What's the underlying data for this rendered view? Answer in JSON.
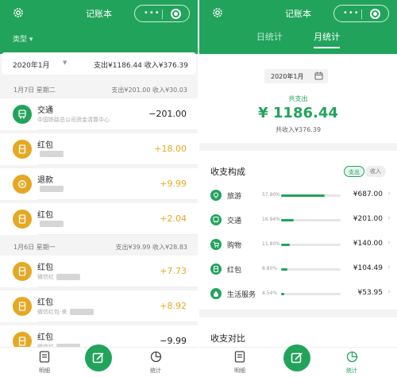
{
  "app": {
    "title": "记账本",
    "capsule_dots": "•••"
  },
  "colors": {
    "brand": "#22a35c",
    "income": "#e5a823",
    "expense": "#222222"
  },
  "left": {
    "type_filter": "类型",
    "month_bar": {
      "month": "2020年1月",
      "summary": "支出¥1186.44   收入¥376.39"
    },
    "days": [
      {
        "date": "1月7日 星期二",
        "summary": "支出¥201.00  收入¥30.03",
        "records": [
          {
            "category": "交通",
            "note": "中国铁路总公司资金清算中心",
            "amount": "−201.00",
            "kind": "expense",
            "icon": "bus-icon"
          },
          {
            "category": "红包",
            "note": "",
            "amount": "+18.00",
            "kind": "income",
            "icon": "envelope-icon"
          },
          {
            "category": "退款",
            "note": "",
            "amount": "+9.99",
            "kind": "income",
            "icon": "refund-icon"
          },
          {
            "category": "红包",
            "note": "",
            "amount": "+2.04",
            "kind": "income",
            "icon": "envelope-icon"
          }
        ]
      },
      {
        "date": "1月6日 星期一",
        "summary": "支出¥39.99  收入¥28.83",
        "records": [
          {
            "category": "红包",
            "note": "微信红",
            "amount": "+7.73",
            "kind": "income",
            "icon": "envelope-icon"
          },
          {
            "category": "红包",
            "note": "微信红包-来",
            "amount": "+8.92",
            "kind": "income",
            "icon": "envelope-icon"
          },
          {
            "category": "红包",
            "note": "微信红",
            "amount": "−9.99",
            "kind": "expense",
            "icon": "envelope-icon"
          }
        ]
      }
    ],
    "nav": {
      "details": "明细",
      "stats": "统计"
    }
  },
  "right": {
    "tabs": {
      "daily": "日统计",
      "monthly": "月统计"
    },
    "month": "2020年1月",
    "expense_label": "共支出",
    "expense_total": "¥ 1186.44",
    "income_total": "共收入¥376.39",
    "composition": {
      "title": "收支构成",
      "toggle_expense": "支出",
      "toggle_income": "收入",
      "rows": [
        {
          "name": "旅游",
          "percent_label": "57.90%",
          "percent": 57.9,
          "amount": "¥687.00",
          "icon": "travel-icon"
        },
        {
          "name": "交通",
          "percent_label": "16.94%",
          "percent": 16.94,
          "amount": "¥201.00",
          "icon": "bus-icon"
        },
        {
          "name": "购物",
          "percent_label": "11.80%",
          "percent": 11.8,
          "amount": "¥140.00",
          "icon": "cart-icon"
        },
        {
          "name": "红包",
          "percent_label": "8.80%",
          "percent": 8.8,
          "amount": "¥104.49",
          "icon": "envelope-icon"
        },
        {
          "name": "生活服务",
          "percent_label": "4.54%",
          "percent": 4.54,
          "amount": "¥53.95",
          "icon": "service-icon"
        }
      ]
    },
    "compare_title": "收支对比",
    "nav": {
      "details": "明细",
      "stats": "统计"
    }
  }
}
